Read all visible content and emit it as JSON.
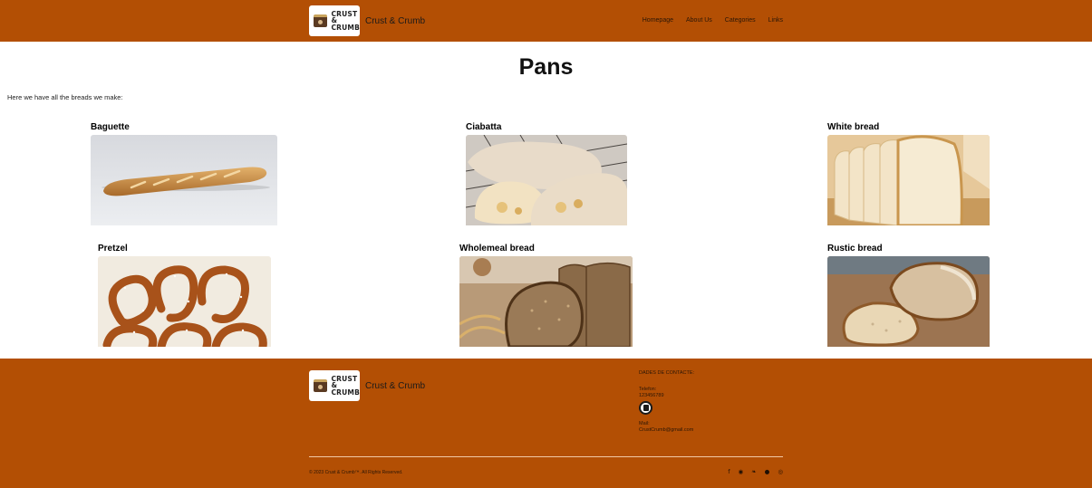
{
  "header": {
    "logo_lines": [
      "CRUST",
      "&",
      "CRUMB"
    ],
    "brand": "Crust & Crumb",
    "nav": [
      "Homepage",
      "About Us",
      "Categories",
      "Links"
    ]
  },
  "main": {
    "title": "Pans",
    "intro": "Here we have all the breads we make:",
    "breads": [
      {
        "name": "Baguette"
      },
      {
        "name": "Ciabatta"
      },
      {
        "name": "White bread"
      },
      {
        "name": "Pretzel"
      },
      {
        "name": "Wholemeal bread"
      },
      {
        "name": "Rustic bread"
      }
    ]
  },
  "footer": {
    "logo_lines": [
      "CRUST",
      "&",
      "CRUMB"
    ],
    "brand": "Crust & Crumb",
    "contact_heading": "DADES DE CONTACTE:",
    "phone_label": "Telefon:",
    "phone_number": "123456789",
    "mail_label": "Mail:",
    "mail": "CrustCrumb@gmail.com",
    "copyright": "© 2023 Crust & Crumb™. All Rights Reserved.",
    "socials": [
      "facebook-icon",
      "discord-icon",
      "twitter-icon",
      "github-icon",
      "dribbble-icon"
    ]
  },
  "colors": {
    "brand_orange": "#b34f04",
    "text_dark": "#111111"
  }
}
